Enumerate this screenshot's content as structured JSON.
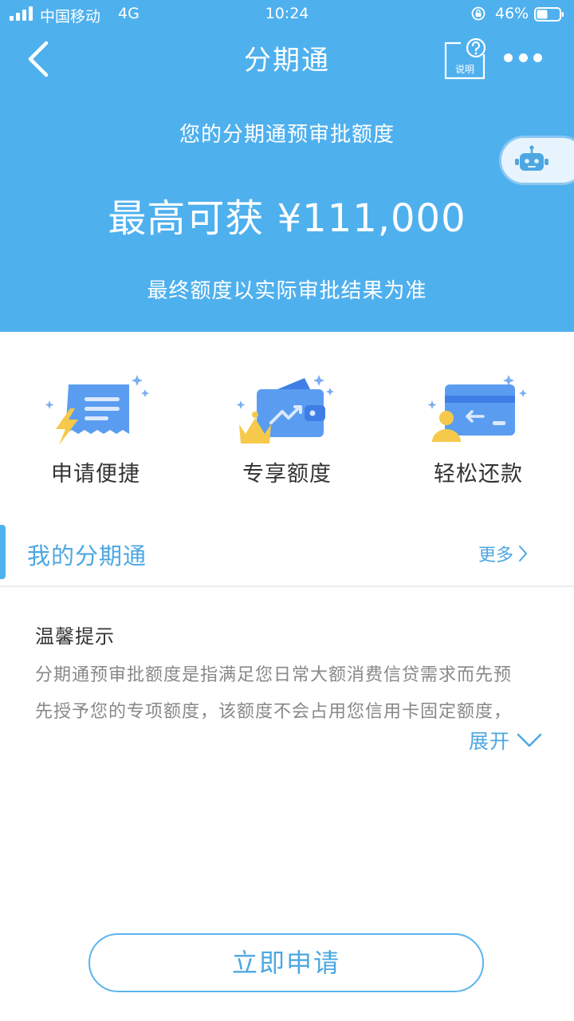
{
  "status_bar": {
    "carrier": "中国移动",
    "network": "4G",
    "time": "10:24",
    "battery": "46%"
  },
  "nav": {
    "title": "分期通",
    "help_label": "说明"
  },
  "hero": {
    "subtitle": "您的分期通预审批额度",
    "amount": "最高可获 ¥111,000",
    "note": "最终额度以实际审批结果为准"
  },
  "features": [
    {
      "label": "申请便捷",
      "icon": "receipt-lightning-icon"
    },
    {
      "label": "专享额度",
      "icon": "wallet-crown-icon"
    },
    {
      "label": "轻松还款",
      "icon": "card-user-icon"
    }
  ],
  "my_section": {
    "title": "我的分期通",
    "more": "更多"
  },
  "tips": {
    "title": "温馨提示",
    "lines": [
      "分期通预审批额度是指满足您日常大额消费信贷需求而先预",
      "先授予您的专项额度，该额度不会占用您信用卡固定额度，"
    ],
    "expand": "展开"
  },
  "apply_button": "立即申请",
  "colors": {
    "primary": "#4fb0ee",
    "accent_text": "#4da7e2"
  }
}
